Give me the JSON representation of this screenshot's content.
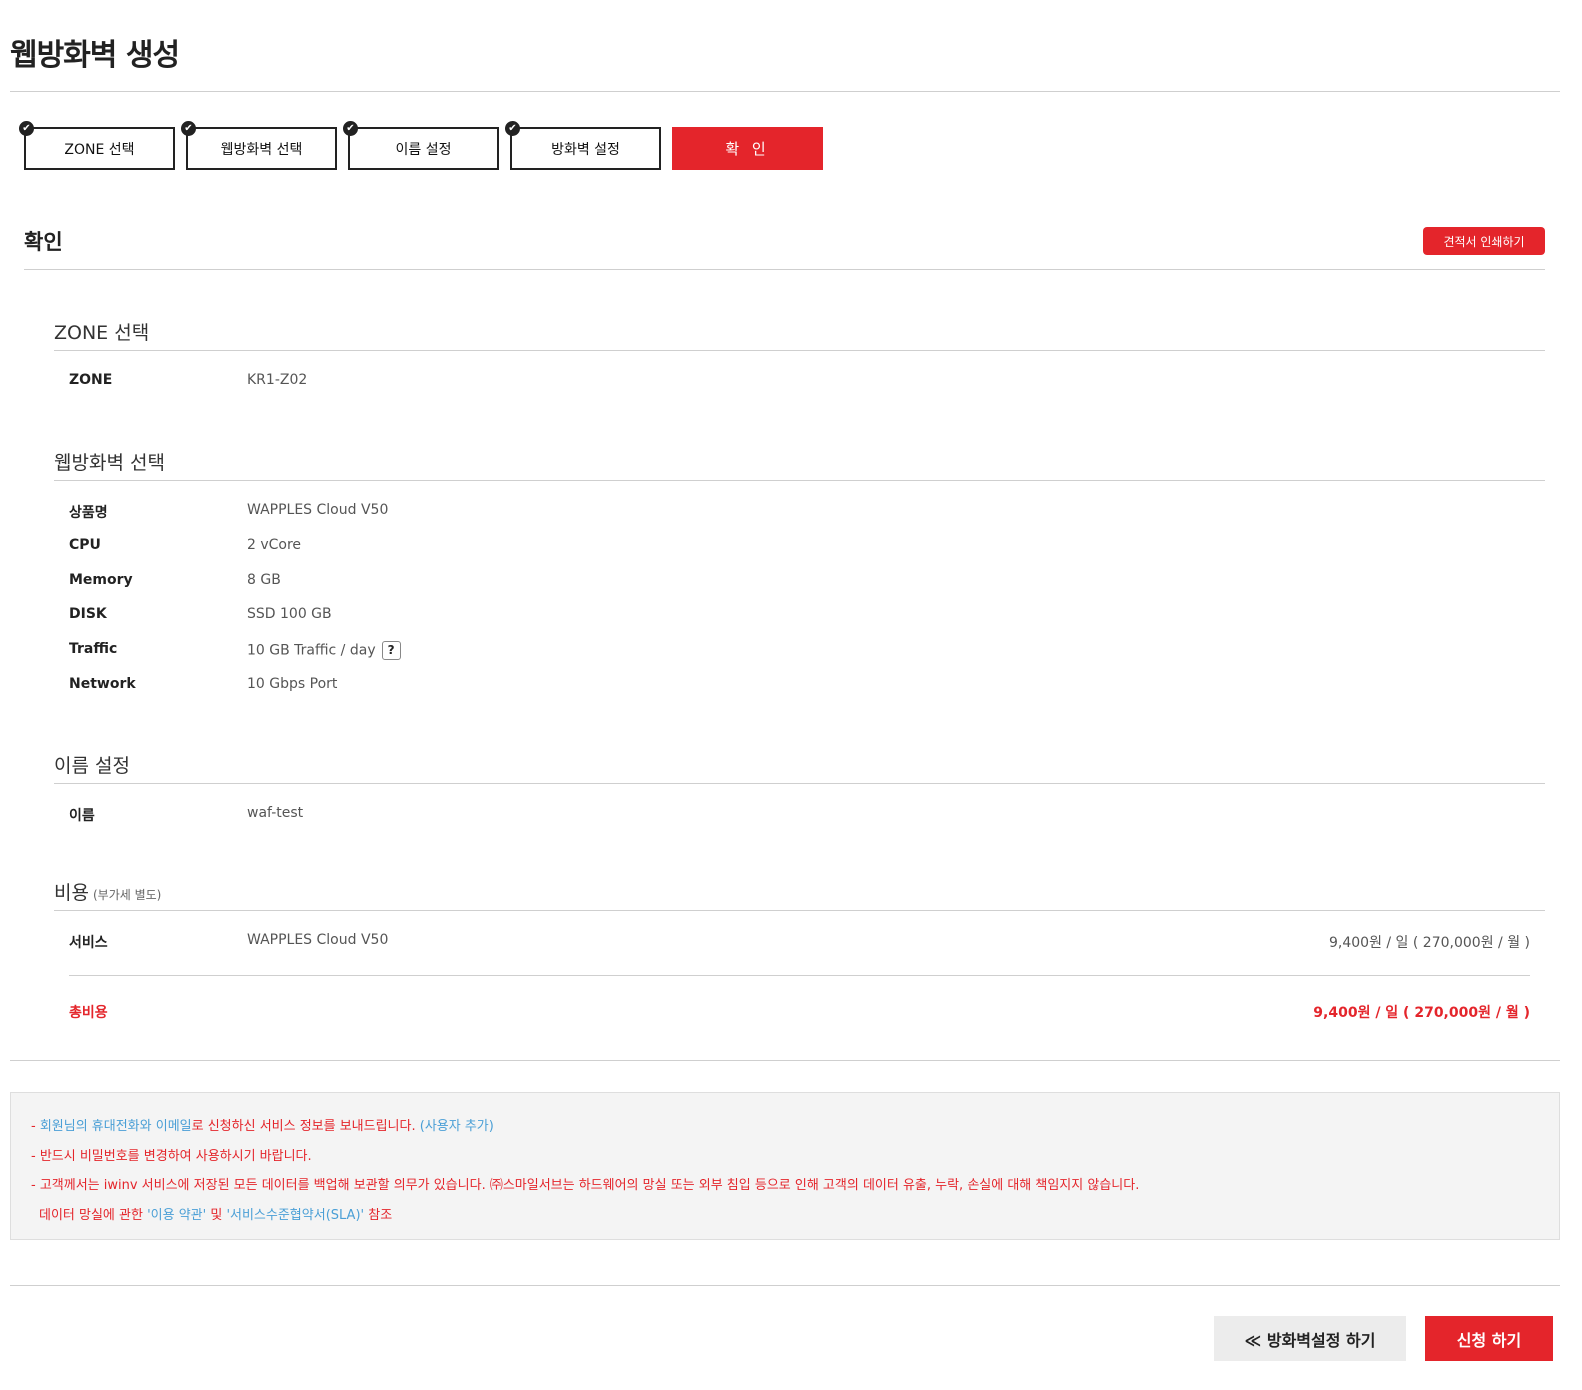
{
  "page": {
    "title": "웹방화벽 생성"
  },
  "steps": [
    {
      "label": "ZONE 선택"
    },
    {
      "label": "웹방화벽 선택"
    },
    {
      "label": "이름 설정"
    },
    {
      "label": "방화벽 설정"
    },
    {
      "label": "확 인"
    }
  ],
  "confirm": {
    "title": "확인",
    "print_button": "견적서 인쇄하기"
  },
  "zone": {
    "title": "ZONE 선택",
    "rows": [
      {
        "key": "ZONE",
        "value": "KR1-Z02"
      }
    ]
  },
  "waf": {
    "title": "웹방화벽 선택",
    "rows": [
      {
        "key": "상품명",
        "value": "WAPPLES Cloud V50"
      },
      {
        "key": "CPU",
        "value": "2 vCore"
      },
      {
        "key": "Memory",
        "value": "8 GB"
      },
      {
        "key": "DISK",
        "value": "SSD 100 GB"
      },
      {
        "key": "Traffic",
        "value": "10 GB Traffic / day"
      },
      {
        "key": "Network",
        "value": "10 Gbps Port"
      }
    ],
    "traffic_help": "?"
  },
  "name": {
    "title": "이름 설정",
    "rows": [
      {
        "key": "이름",
        "value": "waf-test"
      }
    ]
  },
  "cost": {
    "title": "비용",
    "subtitle": "(부가세 별도)",
    "service": {
      "key": "서비스",
      "value": "WAPPLES Cloud V50",
      "price": "9,400원 / 일 ( 270,000원 / 월 )"
    },
    "total": {
      "key": "총비용",
      "price": "9,400원 / 일 ( 270,000원 / 월 )"
    }
  },
  "notice": {
    "line1_prefix": "- ",
    "line1_blue1": "회원님의 휴대전화와 이메일",
    "line1_mid": "로 신청하신 서비스 정보를 보내드립니다. ",
    "line1_blue2": "(사용자 추가)",
    "line2": "- 반드시 비밀번호를 변경하여 사용하시기 바랍니다.",
    "line3": "- 고객께서는 iwinv 서비스에 저장된 모든 데이터를 백업해 보관할 의무가 있습니다. ㈜스마일서브는 하드웨어의 망실 또는 외부 침입 등으로 인해 고객의 데이터 유출, 누락, 손실에 대해 책임지지 않습니다.",
    "line4_prefix": "데이터 망실에 관한 ",
    "line4_link1": "'이용 약관'",
    "line4_mid": " 및 ",
    "line4_link2": "'서비스수준협약서(SLA)'",
    "line4_suffix": " 참조"
  },
  "buttons": {
    "prev": "≪ 방화벽설정 하기",
    "submit": "신청 하기"
  }
}
